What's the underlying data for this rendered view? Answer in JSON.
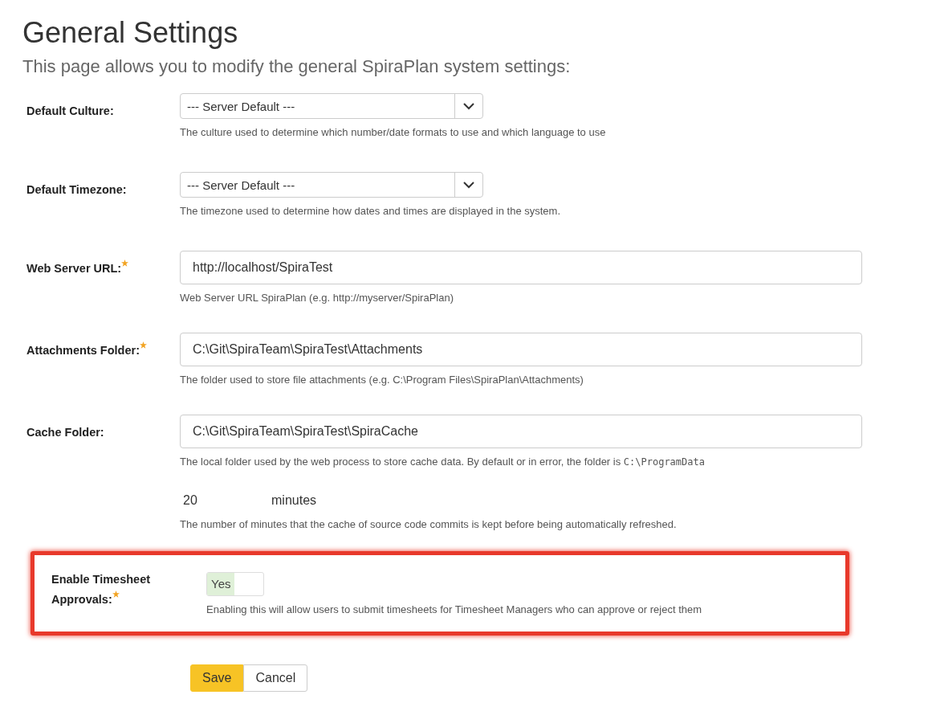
{
  "title": "General Settings",
  "subtitle": "This page allows you to modify the general SpiraPlan system settings:",
  "fields": [
    {
      "kind": "select",
      "label": "Default Culture:",
      "required": false,
      "value": "--- Server Default ---",
      "hint": "The culture used to determine which number/date formats to use and which language to use"
    },
    {
      "kind": "select",
      "label": "Default Timezone:",
      "required": false,
      "value": "--- Server Default ---",
      "hint": "The timezone used to determine how dates and times are displayed in the system."
    },
    {
      "kind": "text",
      "label": "Web Server URL:",
      "required": true,
      "value": "http://localhost/SpiraTest",
      "hint": "Web Server URL SpiraPlan (e.g. http://myserver/SpiraPlan)"
    },
    {
      "kind": "text",
      "label": "Attachments Folder:",
      "required": true,
      "value": "C:\\Git\\SpiraTeam\\SpiraTest\\Attachments",
      "hint": "The folder used to store file attachments (e.g. C:\\Program Files\\SpiraPlan\\Attachments)"
    },
    {
      "kind": "text",
      "label": "Cache Folder:",
      "required": false,
      "value": "C:\\Git\\SpiraTeam\\SpiraTest\\SpiraCache",
      "hint": "The local folder used by the web process to store cache data. By default or in error, the folder is",
      "hint_code": "C:\\ProgramData"
    },
    {
      "kind": "minutes",
      "value": "20",
      "unit": "minutes",
      "hint": "The number of minutes that the cache of source code commits is kept before being automatically refreshed."
    },
    {
      "kind": "toggle",
      "label": "Enable Timesheet Approvals:",
      "required": true,
      "highlighted": true,
      "on": true,
      "value": "Yes",
      "hint": "Enabling this will allow users to submit timesheets for Timesheet Managers who can approve or reject them"
    }
  ],
  "buttons": [
    {
      "label": "Save",
      "primary": true
    },
    {
      "label": "Cancel",
      "primary": false
    }
  ]
}
